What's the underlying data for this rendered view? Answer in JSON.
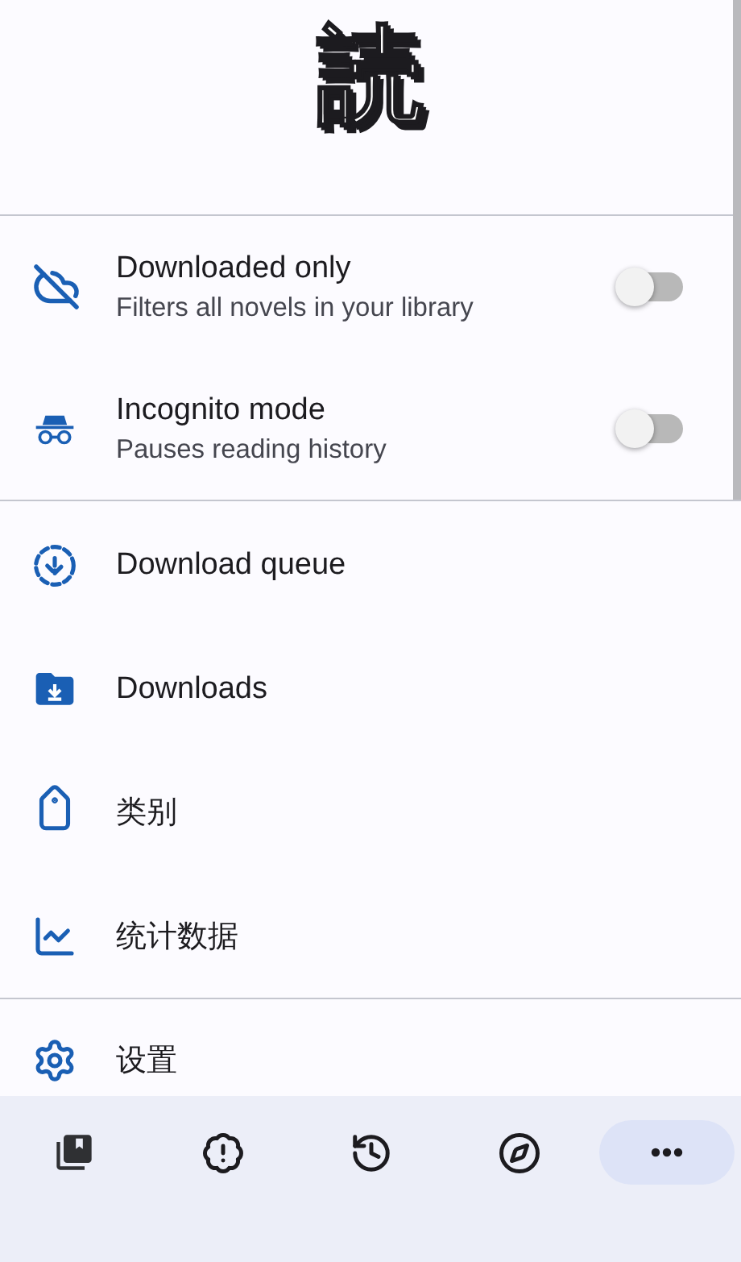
{
  "logo": "読",
  "toggles": [
    {
      "title": "Downloaded only",
      "subtitle": "Filters all novels in your library",
      "on": false,
      "kind": "cloud"
    },
    {
      "title": "Incognito mode",
      "subtitle": "Pauses reading history",
      "on": false,
      "kind": "incognito"
    }
  ],
  "menu": [
    {
      "label": "Download queue",
      "kind": "queue"
    },
    {
      "label": "Downloads",
      "kind": "folder"
    },
    {
      "label": "类别",
      "kind": "label"
    },
    {
      "label": "统计数据",
      "kind": "stats"
    }
  ],
  "settings": {
    "label": "设置",
    "kind": "settings"
  },
  "nav": [
    {
      "kind": "library",
      "selected": false
    },
    {
      "kind": "updates",
      "selected": false
    },
    {
      "kind": "history",
      "selected": false
    },
    {
      "kind": "browse",
      "selected": false
    },
    {
      "kind": "more",
      "selected": true
    }
  ]
}
